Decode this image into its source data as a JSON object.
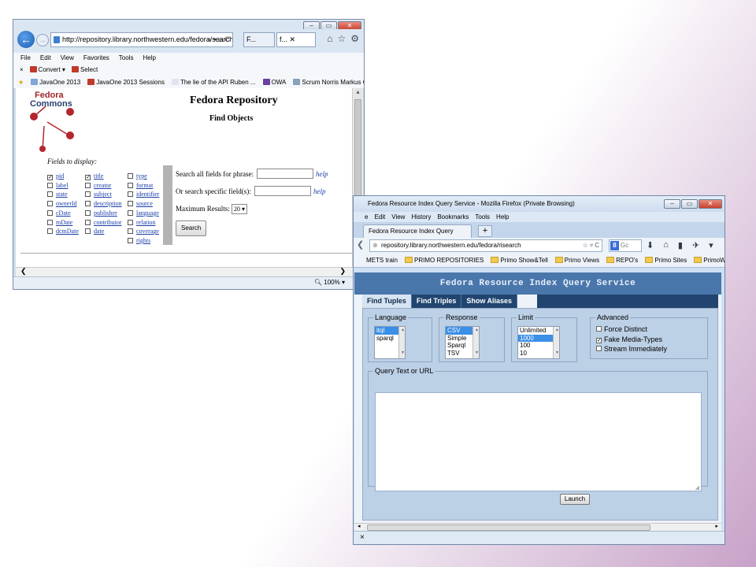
{
  "ie": {
    "window_buttons": [
      "–",
      "▭",
      "✕"
    ],
    "address": "http://repository.library.northwestern.edu/fedora/search",
    "address_domain": "northwestern.edu",
    "address_controls": "⌕ ▾ ⊟ C",
    "tabs": [
      "F...",
      "f..."
    ],
    "menu": [
      "File",
      "Edit",
      "View",
      "Favorites",
      "Tools",
      "Help"
    ],
    "command_bar": {
      "close": "×",
      "convert": "Convert",
      "select": "Select"
    },
    "favorites": [
      "JavaOne 2013",
      "JavaOne 2013 Sessions",
      "The lie of the API  Ruben ...",
      "OWA",
      "Scrum Norris  Markus Gär..."
    ],
    "favorites_more": "»",
    "zoom": "100%",
    "page": {
      "logo_word1": "Fedora",
      "logo_word2": "Commons",
      "title": "Fedora Repository",
      "subtitle": "Find Objects",
      "fields_label": "Fields to display:",
      "field_columns": [
        [
          {
            "label": "pid",
            "checked": true
          },
          {
            "label": "label",
            "checked": false
          },
          {
            "label": "state",
            "checked": false
          },
          {
            "label": "ownerId",
            "checked": false
          },
          {
            "label": "cDate",
            "checked": false
          },
          {
            "label": "mDate",
            "checked": false
          },
          {
            "label": "dcmDate",
            "checked": false
          }
        ],
        [
          {
            "label": "title",
            "checked": true
          },
          {
            "label": "creator",
            "checked": false
          },
          {
            "label": "subject",
            "checked": false
          },
          {
            "label": "description",
            "checked": false
          },
          {
            "label": "publisher",
            "checked": false
          },
          {
            "label": "contributor",
            "checked": false
          },
          {
            "label": "date",
            "checked": false
          }
        ],
        [
          {
            "label": "type",
            "checked": false
          },
          {
            "label": "format",
            "checked": false
          },
          {
            "label": "identifier",
            "checked": false
          },
          {
            "label": "source",
            "checked": false
          },
          {
            "label": "language",
            "checked": false
          },
          {
            "label": "relation",
            "checked": false
          },
          {
            "label": "coverage",
            "checked": false
          },
          {
            "label": "rights",
            "checked": false
          }
        ]
      ],
      "search_all_label": "Search all fields for phrase:",
      "search_specific_label": "Or search specific field(s):",
      "help": "help",
      "max_results_label": "Maximum Results:",
      "max_results_value": "20",
      "search_button": "Search"
    }
  },
  "ff": {
    "title": "Fedora Resource Index Query Service - Mozilla Firefox (Private Browsing)",
    "menu": [
      "e",
      "Edit",
      "View",
      "History",
      "Bookmarks",
      "Tools",
      "Help"
    ],
    "tab_label": "Fedora Resource Index Query Service",
    "new_tab": "+",
    "address": "repository.library.northwestern.edu/fedora/risearch",
    "address_controls": "☆ ▿ C",
    "search_placeholder": "Gc",
    "search_engine": "8",
    "bookmarks": [
      "METS train",
      "PRIMO REPOSITORIES",
      "Primo Show&Tell",
      "Primo Views",
      "REPO's",
      "Primo Sites",
      "PrimoWorld"
    ],
    "bookmarks_more": "»",
    "page": {
      "banner": "Fedora Resource Index Query Service",
      "tabs": [
        "Find Tuples",
        "Find Triples",
        "Show Aliases"
      ],
      "language": {
        "legend": "Language",
        "options": [
          "itql",
          "sparql"
        ],
        "selected": "itql"
      },
      "response": {
        "legend": "Response",
        "options": [
          "CSV",
          "Simple",
          "Sparql",
          "TSV"
        ],
        "selected": "CSV"
      },
      "limit": {
        "legend": "Limit",
        "options": [
          "Unlimited",
          "1000",
          "100",
          "10"
        ],
        "selected": "1000"
      },
      "advanced": {
        "legend": "Advanced",
        "options": [
          {
            "label": "Force Distinct",
            "checked": false
          },
          {
            "label": "Fake Media-Types",
            "checked": true
          },
          {
            "label": "Stream Immediately",
            "checked": false
          }
        ]
      },
      "query_legend": "Query Text or URL",
      "launch_button": "Launch"
    },
    "findbar_close": "×"
  }
}
